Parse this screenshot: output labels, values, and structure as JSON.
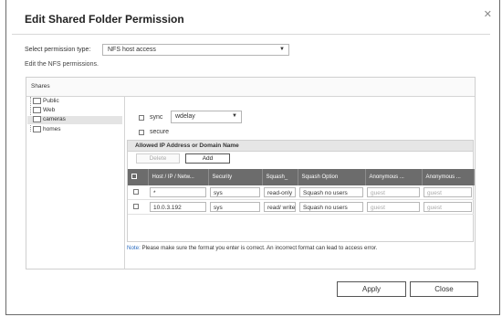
{
  "dialog": {
    "title": "Edit Shared Folder Permission",
    "close_icon": "close-icon"
  },
  "permission": {
    "label": "Select permission type:",
    "selected": "NFS host access",
    "description": "Edit the NFS permissions."
  },
  "shares": {
    "header": "Shares",
    "items": [
      {
        "label": "Public",
        "selected": false
      },
      {
        "label": "Web",
        "selected": false
      },
      {
        "label": "cameras",
        "selected": true
      },
      {
        "label": "homes",
        "selected": false
      }
    ]
  },
  "options": {
    "sync_label": "sync",
    "sync_value": "wdelay",
    "secure_label": "secure"
  },
  "ip_panel": {
    "header": "Allowed IP Address or Domain Name",
    "delete_label": "Delete",
    "add_label": "Add",
    "columns": [
      "Host / IP / Netw...",
      "Security",
      "Squash_",
      "Squash Option",
      "Anonymous ...",
      "Anonymous ..."
    ],
    "rows": [
      {
        "host": "*",
        "security": "sys",
        "squash": "read-only",
        "squash_option": "Squash no users",
        "anon_uid": "guest",
        "anon_gid": "guest"
      },
      {
        "host": "10.0.3.192",
        "security": "sys",
        "squash": "read/ write",
        "squash_option": "Squash no users",
        "anon_uid": "guest",
        "anon_gid": "guest"
      }
    ]
  },
  "note": {
    "prefix": "Note:",
    "text": " Please make sure the format you enter is correct. An incorrect format can lead to access error."
  },
  "footer": {
    "apply_label": "Apply",
    "close_label": "Close"
  }
}
